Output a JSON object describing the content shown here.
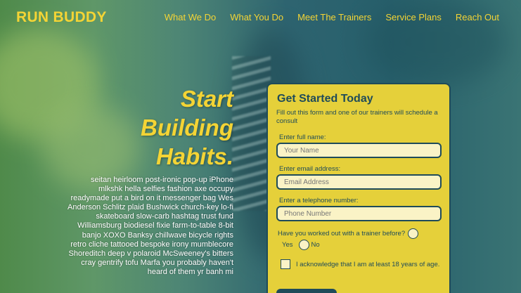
{
  "header": {
    "logo": "RUN BUDDY",
    "nav": [
      "What We Do",
      "What You Do",
      "Meet The Trainers",
      "Service Plans",
      "Reach Out"
    ]
  },
  "hero": {
    "title_lines": [
      "Start",
      "Building",
      "Habits."
    ],
    "body": "seitan heirloom post-ironic pop-up iPhone mlkshk hella selfies fashion axe occupy readymade put a bird on it messenger bag Wes Anderson Schlitz plaid Bushwick church-key lo-fi skateboard slow-carb hashtag trust fund Williamsburg biodiesel fixie farm-to-table 8-bit banjo XOXO Banksy chillwave bicycle rights retro cliche tattooed bespoke irony mumblecore Shoreditch deep v polaroid McSweeney's bitters cray gentrify tofu Marfa you probably haven't heard of them yr banh mi"
  },
  "form": {
    "title": "Get Started Today",
    "subtitle": "Fill out this form and one of our trainers will schedule a consult",
    "name_label": "Enter full name:",
    "name_placeholder": "Your Name",
    "email_label": "Enter email address:",
    "email_placeholder": "Email Address",
    "phone_label": "Enter a telephone number:",
    "phone_placeholder": "Phone Number",
    "question": "Have you worked out with a trainer before?",
    "yes_label": "Yes",
    "no_label": "No",
    "acknowledge": "I acknowledge that I am at least 18 years of age."
  },
  "colors": {
    "accent_yellow": "#f4d435",
    "form_background": "#e5d03a",
    "form_navy": "#1f4b59"
  }
}
